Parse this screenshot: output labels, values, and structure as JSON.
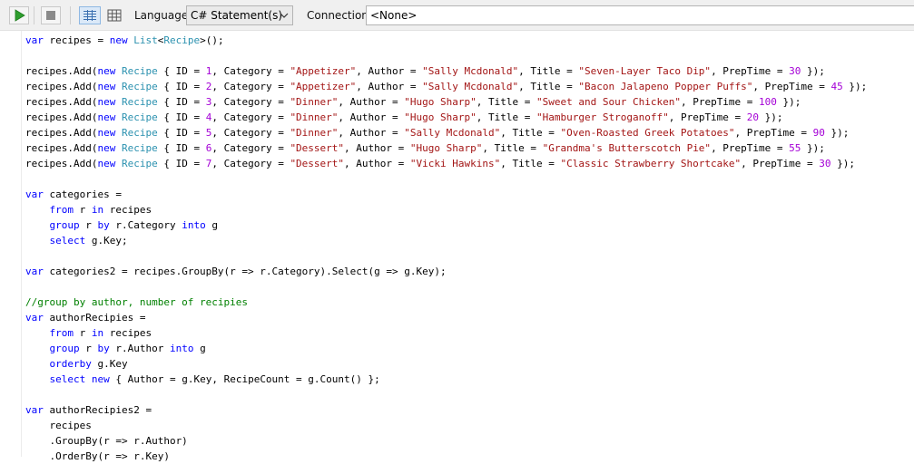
{
  "toolbar": {
    "language_label": "Language",
    "language_value": "C# Statement(s)",
    "connection_label": "Connection",
    "connection_value": "<None>"
  },
  "colors": {
    "keyword": "#0000ff",
    "type": "#2b91af",
    "string": "#a31515",
    "number": "#a400d6",
    "comment": "#008000",
    "run_icon": "#2e9e2e"
  },
  "icons": [
    "run-icon",
    "stop-icon",
    "rich-text-view-icon",
    "grid-view-icon",
    "chevron-down-icon"
  ],
  "editor": {
    "lines": [
      [
        [
          "kw",
          "var"
        ],
        [
          "pl",
          " recipes = "
        ],
        [
          "kw",
          "new"
        ],
        [
          "pl",
          " "
        ],
        [
          "ty",
          "List"
        ],
        [
          "pl",
          "<"
        ],
        [
          "ty",
          "Recipe"
        ],
        [
          "pl",
          ">();"
        ]
      ],
      [],
      [
        [
          "pl",
          "recipes.Add("
        ],
        [
          "kw",
          "new"
        ],
        [
          "pl",
          " "
        ],
        [
          "ty",
          "Recipe"
        ],
        [
          "pl",
          " { ID = "
        ],
        [
          "nm",
          "1"
        ],
        [
          "pl",
          ", Category = "
        ],
        [
          "st",
          "\"Appetizer\""
        ],
        [
          "pl",
          ", Author = "
        ],
        [
          "st",
          "\"Sally Mcdonald\""
        ],
        [
          "pl",
          ", Title = "
        ],
        [
          "st",
          "\"Seven-Layer Taco Dip\""
        ],
        [
          "pl",
          ", PrepTime = "
        ],
        [
          "nm",
          "30"
        ],
        [
          "pl",
          " });"
        ]
      ],
      [
        [
          "pl",
          "recipes.Add("
        ],
        [
          "kw",
          "new"
        ],
        [
          "pl",
          " "
        ],
        [
          "ty",
          "Recipe"
        ],
        [
          "pl",
          " { ID = "
        ],
        [
          "nm",
          "2"
        ],
        [
          "pl",
          ", Category = "
        ],
        [
          "st",
          "\"Appetizer\""
        ],
        [
          "pl",
          ", Author = "
        ],
        [
          "st",
          "\"Sally Mcdonald\""
        ],
        [
          "pl",
          ", Title = "
        ],
        [
          "st",
          "\"Bacon Jalapeno Popper Puffs\""
        ],
        [
          "pl",
          ", PrepTime = "
        ],
        [
          "nm",
          "45"
        ],
        [
          "pl",
          " });"
        ]
      ],
      [
        [
          "pl",
          "recipes.Add("
        ],
        [
          "kw",
          "new"
        ],
        [
          "pl",
          " "
        ],
        [
          "ty",
          "Recipe"
        ],
        [
          "pl",
          " { ID = "
        ],
        [
          "nm",
          "3"
        ],
        [
          "pl",
          ", Category = "
        ],
        [
          "st",
          "\"Dinner\""
        ],
        [
          "pl",
          ", Author = "
        ],
        [
          "st",
          "\"Hugo Sharp\""
        ],
        [
          "pl",
          ", Title = "
        ],
        [
          "st",
          "\"Sweet and Sour Chicken\""
        ],
        [
          "pl",
          ", PrepTime = "
        ],
        [
          "nm",
          "100"
        ],
        [
          "pl",
          " });"
        ]
      ],
      [
        [
          "pl",
          "recipes.Add("
        ],
        [
          "kw",
          "new"
        ],
        [
          "pl",
          " "
        ],
        [
          "ty",
          "Recipe"
        ],
        [
          "pl",
          " { ID = "
        ],
        [
          "nm",
          "4"
        ],
        [
          "pl",
          ", Category = "
        ],
        [
          "st",
          "\"Dinner\""
        ],
        [
          "pl",
          ", Author = "
        ],
        [
          "st",
          "\"Hugo Sharp\""
        ],
        [
          "pl",
          ", Title = "
        ],
        [
          "st",
          "\"Hamburger Stroganoff\""
        ],
        [
          "pl",
          ", PrepTime = "
        ],
        [
          "nm",
          "20"
        ],
        [
          "pl",
          " });"
        ]
      ],
      [
        [
          "pl",
          "recipes.Add("
        ],
        [
          "kw",
          "new"
        ],
        [
          "pl",
          " "
        ],
        [
          "ty",
          "Recipe"
        ],
        [
          "pl",
          " { ID = "
        ],
        [
          "nm",
          "5"
        ],
        [
          "pl",
          ", Category = "
        ],
        [
          "st",
          "\"Dinner\""
        ],
        [
          "pl",
          ", Author = "
        ],
        [
          "st",
          "\"Sally Mcdonald\""
        ],
        [
          "pl",
          ", Title = "
        ],
        [
          "st",
          "\"Oven-Roasted Greek Potatoes\""
        ],
        [
          "pl",
          ", PrepTime = "
        ],
        [
          "nm",
          "90"
        ],
        [
          "pl",
          " });"
        ]
      ],
      [
        [
          "pl",
          "recipes.Add("
        ],
        [
          "kw",
          "new"
        ],
        [
          "pl",
          " "
        ],
        [
          "ty",
          "Recipe"
        ],
        [
          "pl",
          " { ID = "
        ],
        [
          "nm",
          "6"
        ],
        [
          "pl",
          ", Category = "
        ],
        [
          "st",
          "\"Dessert\""
        ],
        [
          "pl",
          ", Author = "
        ],
        [
          "st",
          "\"Hugo Sharp\""
        ],
        [
          "pl",
          ", Title = "
        ],
        [
          "st",
          "\"Grandma's Butterscotch Pie\""
        ],
        [
          "pl",
          ", PrepTime = "
        ],
        [
          "nm",
          "55"
        ],
        [
          "pl",
          " });"
        ]
      ],
      [
        [
          "pl",
          "recipes.Add("
        ],
        [
          "kw",
          "new"
        ],
        [
          "pl",
          " "
        ],
        [
          "ty",
          "Recipe"
        ],
        [
          "pl",
          " { ID = "
        ],
        [
          "nm",
          "7"
        ],
        [
          "pl",
          ", Category = "
        ],
        [
          "st",
          "\"Dessert\""
        ],
        [
          "pl",
          ", Author = "
        ],
        [
          "st",
          "\"Vicki Hawkins\""
        ],
        [
          "pl",
          ", Title = "
        ],
        [
          "st",
          "\"Classic Strawberry Shortcake\""
        ],
        [
          "pl",
          ", PrepTime = "
        ],
        [
          "nm",
          "30"
        ],
        [
          "pl",
          " });"
        ]
      ],
      [],
      [
        [
          "kw",
          "var"
        ],
        [
          "pl",
          " categories ="
        ]
      ],
      [
        [
          "pl",
          "    "
        ],
        [
          "kw",
          "from"
        ],
        [
          "pl",
          " r "
        ],
        [
          "kw",
          "in"
        ],
        [
          "pl",
          " recipes"
        ]
      ],
      [
        [
          "pl",
          "    "
        ],
        [
          "kw",
          "group"
        ],
        [
          "pl",
          " r "
        ],
        [
          "kw",
          "by"
        ],
        [
          "pl",
          " r.Category "
        ],
        [
          "kw",
          "into"
        ],
        [
          "pl",
          " g"
        ]
      ],
      [
        [
          "pl",
          "    "
        ],
        [
          "kw",
          "select"
        ],
        [
          "pl",
          " g.Key;"
        ]
      ],
      [],
      [
        [
          "kw",
          "var"
        ],
        [
          "pl",
          " categories2 = recipes.GroupBy(r => r.Category).Select(g => g.Key);"
        ]
      ],
      [],
      [
        [
          "cm",
          "//group by author, number of recipies"
        ]
      ],
      [
        [
          "kw",
          "var"
        ],
        [
          "pl",
          " authorRecipies ="
        ]
      ],
      [
        [
          "pl",
          "    "
        ],
        [
          "kw",
          "from"
        ],
        [
          "pl",
          " r "
        ],
        [
          "kw",
          "in"
        ],
        [
          "pl",
          " recipes"
        ]
      ],
      [
        [
          "pl",
          "    "
        ],
        [
          "kw",
          "group"
        ],
        [
          "pl",
          " r "
        ],
        [
          "kw",
          "by"
        ],
        [
          "pl",
          " r.Author "
        ],
        [
          "kw",
          "into"
        ],
        [
          "pl",
          " g"
        ]
      ],
      [
        [
          "pl",
          "    "
        ],
        [
          "kw",
          "orderby"
        ],
        [
          "pl",
          " g.Key"
        ]
      ],
      [
        [
          "pl",
          "    "
        ],
        [
          "kw",
          "select"
        ],
        [
          "pl",
          " "
        ],
        [
          "kw",
          "new"
        ],
        [
          "pl",
          " { Author = g.Key, RecipeCount = g.Count() };"
        ]
      ],
      [],
      [
        [
          "kw",
          "var"
        ],
        [
          "pl",
          " authorRecipies2 ="
        ]
      ],
      [
        [
          "pl",
          "    recipes"
        ]
      ],
      [
        [
          "pl",
          "    .GroupBy(r => r.Author)"
        ]
      ],
      [
        [
          "pl",
          "    .OrderBy(r => r.Key)"
        ]
      ]
    ]
  }
}
